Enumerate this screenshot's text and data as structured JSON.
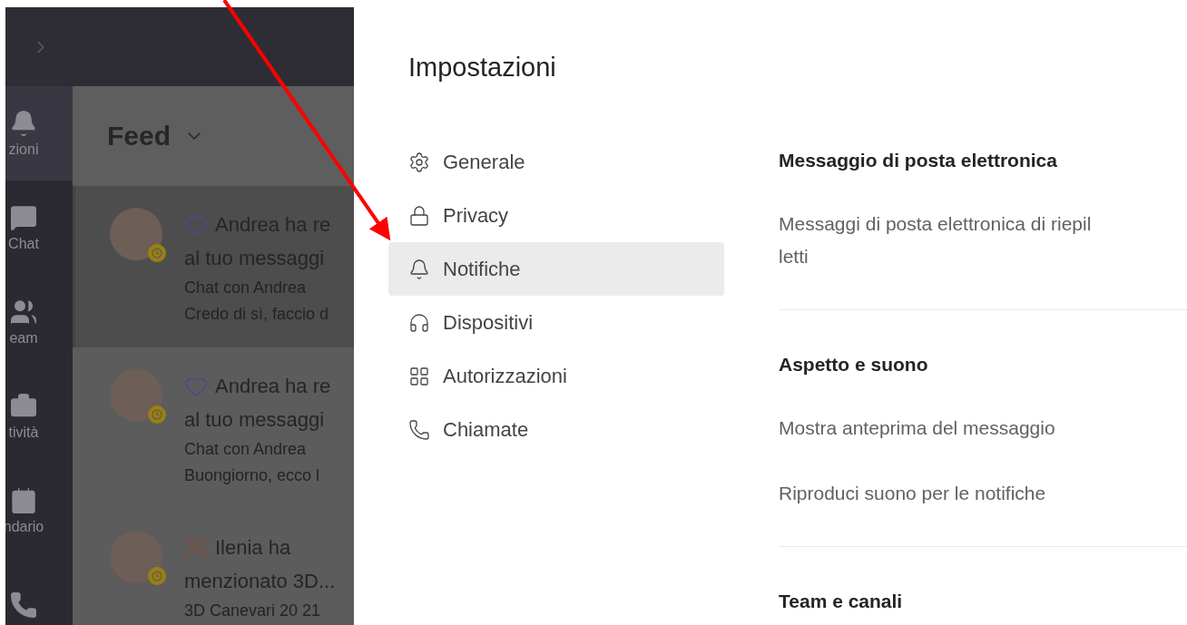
{
  "app": {
    "rail": [
      {
        "label": "zioni",
        "selected": true
      },
      {
        "label": "Chat",
        "selected": false
      },
      {
        "label": "eam",
        "selected": false
      },
      {
        "label": "tività",
        "selected": false
      },
      {
        "label": "ndario",
        "selected": false
      },
      {
        "selected": false
      }
    ],
    "feed": {
      "title": "Feed",
      "items": [
        {
          "kind": "reaction",
          "title_lines": [
            "Andrea ha re",
            "al tuo messaggi"
          ],
          "context": "Chat con Andrea",
          "preview": "Credo di sì, faccio d",
          "selected": true
        },
        {
          "kind": "reaction",
          "title_lines": [
            "Andrea ha re",
            "al tuo messaggi"
          ],
          "context": "Chat con Andrea",
          "preview": "Buongiorno, ecco l",
          "selected": false
        },
        {
          "kind": "mention",
          "title_lines": [
            "Ilenia ha",
            "menzionato 3D..."
          ],
          "context": "3D Canevari 20 21",
          "selected": false
        }
      ]
    }
  },
  "settings": {
    "title": "Impostazioni",
    "nav": [
      {
        "label": "Generale",
        "selected": false
      },
      {
        "label": "Privacy",
        "selected": false
      },
      {
        "label": "Notifiche",
        "selected": true
      },
      {
        "label": "Dispositivi",
        "selected": false
      },
      {
        "label": "Autorizzazioni",
        "selected": false
      },
      {
        "label": "Chiamate",
        "selected": false
      }
    ],
    "sections": [
      {
        "title": "Messaggio di posta elettronica",
        "rows": [
          {
            "lines": [
              "Messaggi di posta elettronica di riepil",
              "letti"
            ]
          }
        ]
      },
      {
        "title": "Aspetto e suono",
        "rows": [
          {
            "lines": [
              "Mostra anteprima del messaggio"
            ]
          },
          {
            "lines": [
              "Riproduci suono per le notifiche"
            ]
          }
        ]
      },
      {
        "title": "Team e canali"
      }
    ]
  }
}
